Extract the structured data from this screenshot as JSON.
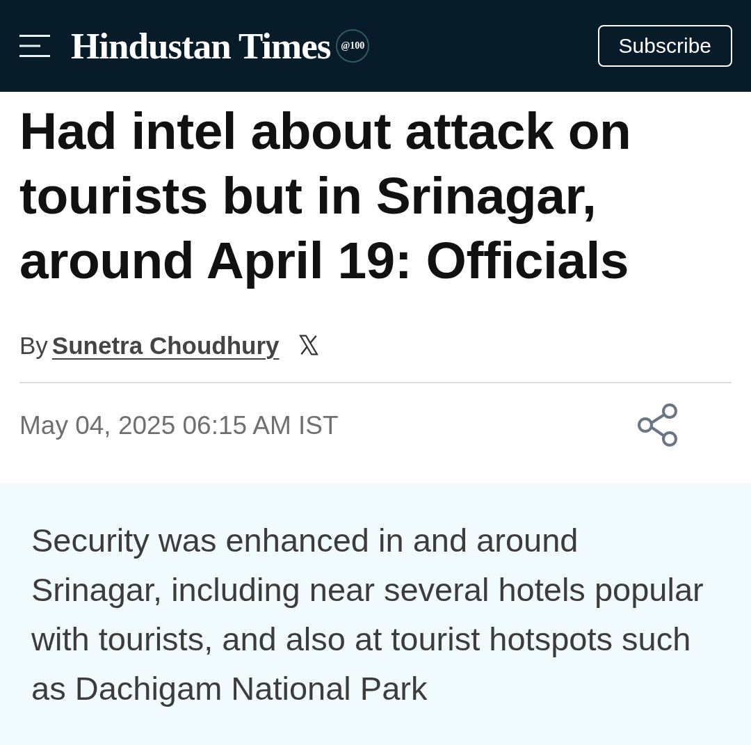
{
  "header": {
    "logo": {
      "name": "Hindustan Times",
      "badge": "@100"
    },
    "subscribe_button": "Subscribe"
  },
  "article": {
    "headline": "Had intel about attack on tourists but in Srinagar, around April 19: Officials",
    "byline": {
      "prefix": "By",
      "author": "Sunetra Choudhury"
    },
    "timestamp": "May 04, 2025 06:15 AM IST",
    "summary": "Security was enhanced in and around Srinagar, including near several hotels popular with tourists, and also at tourist hotspots such as Dachigam National Park"
  }
}
